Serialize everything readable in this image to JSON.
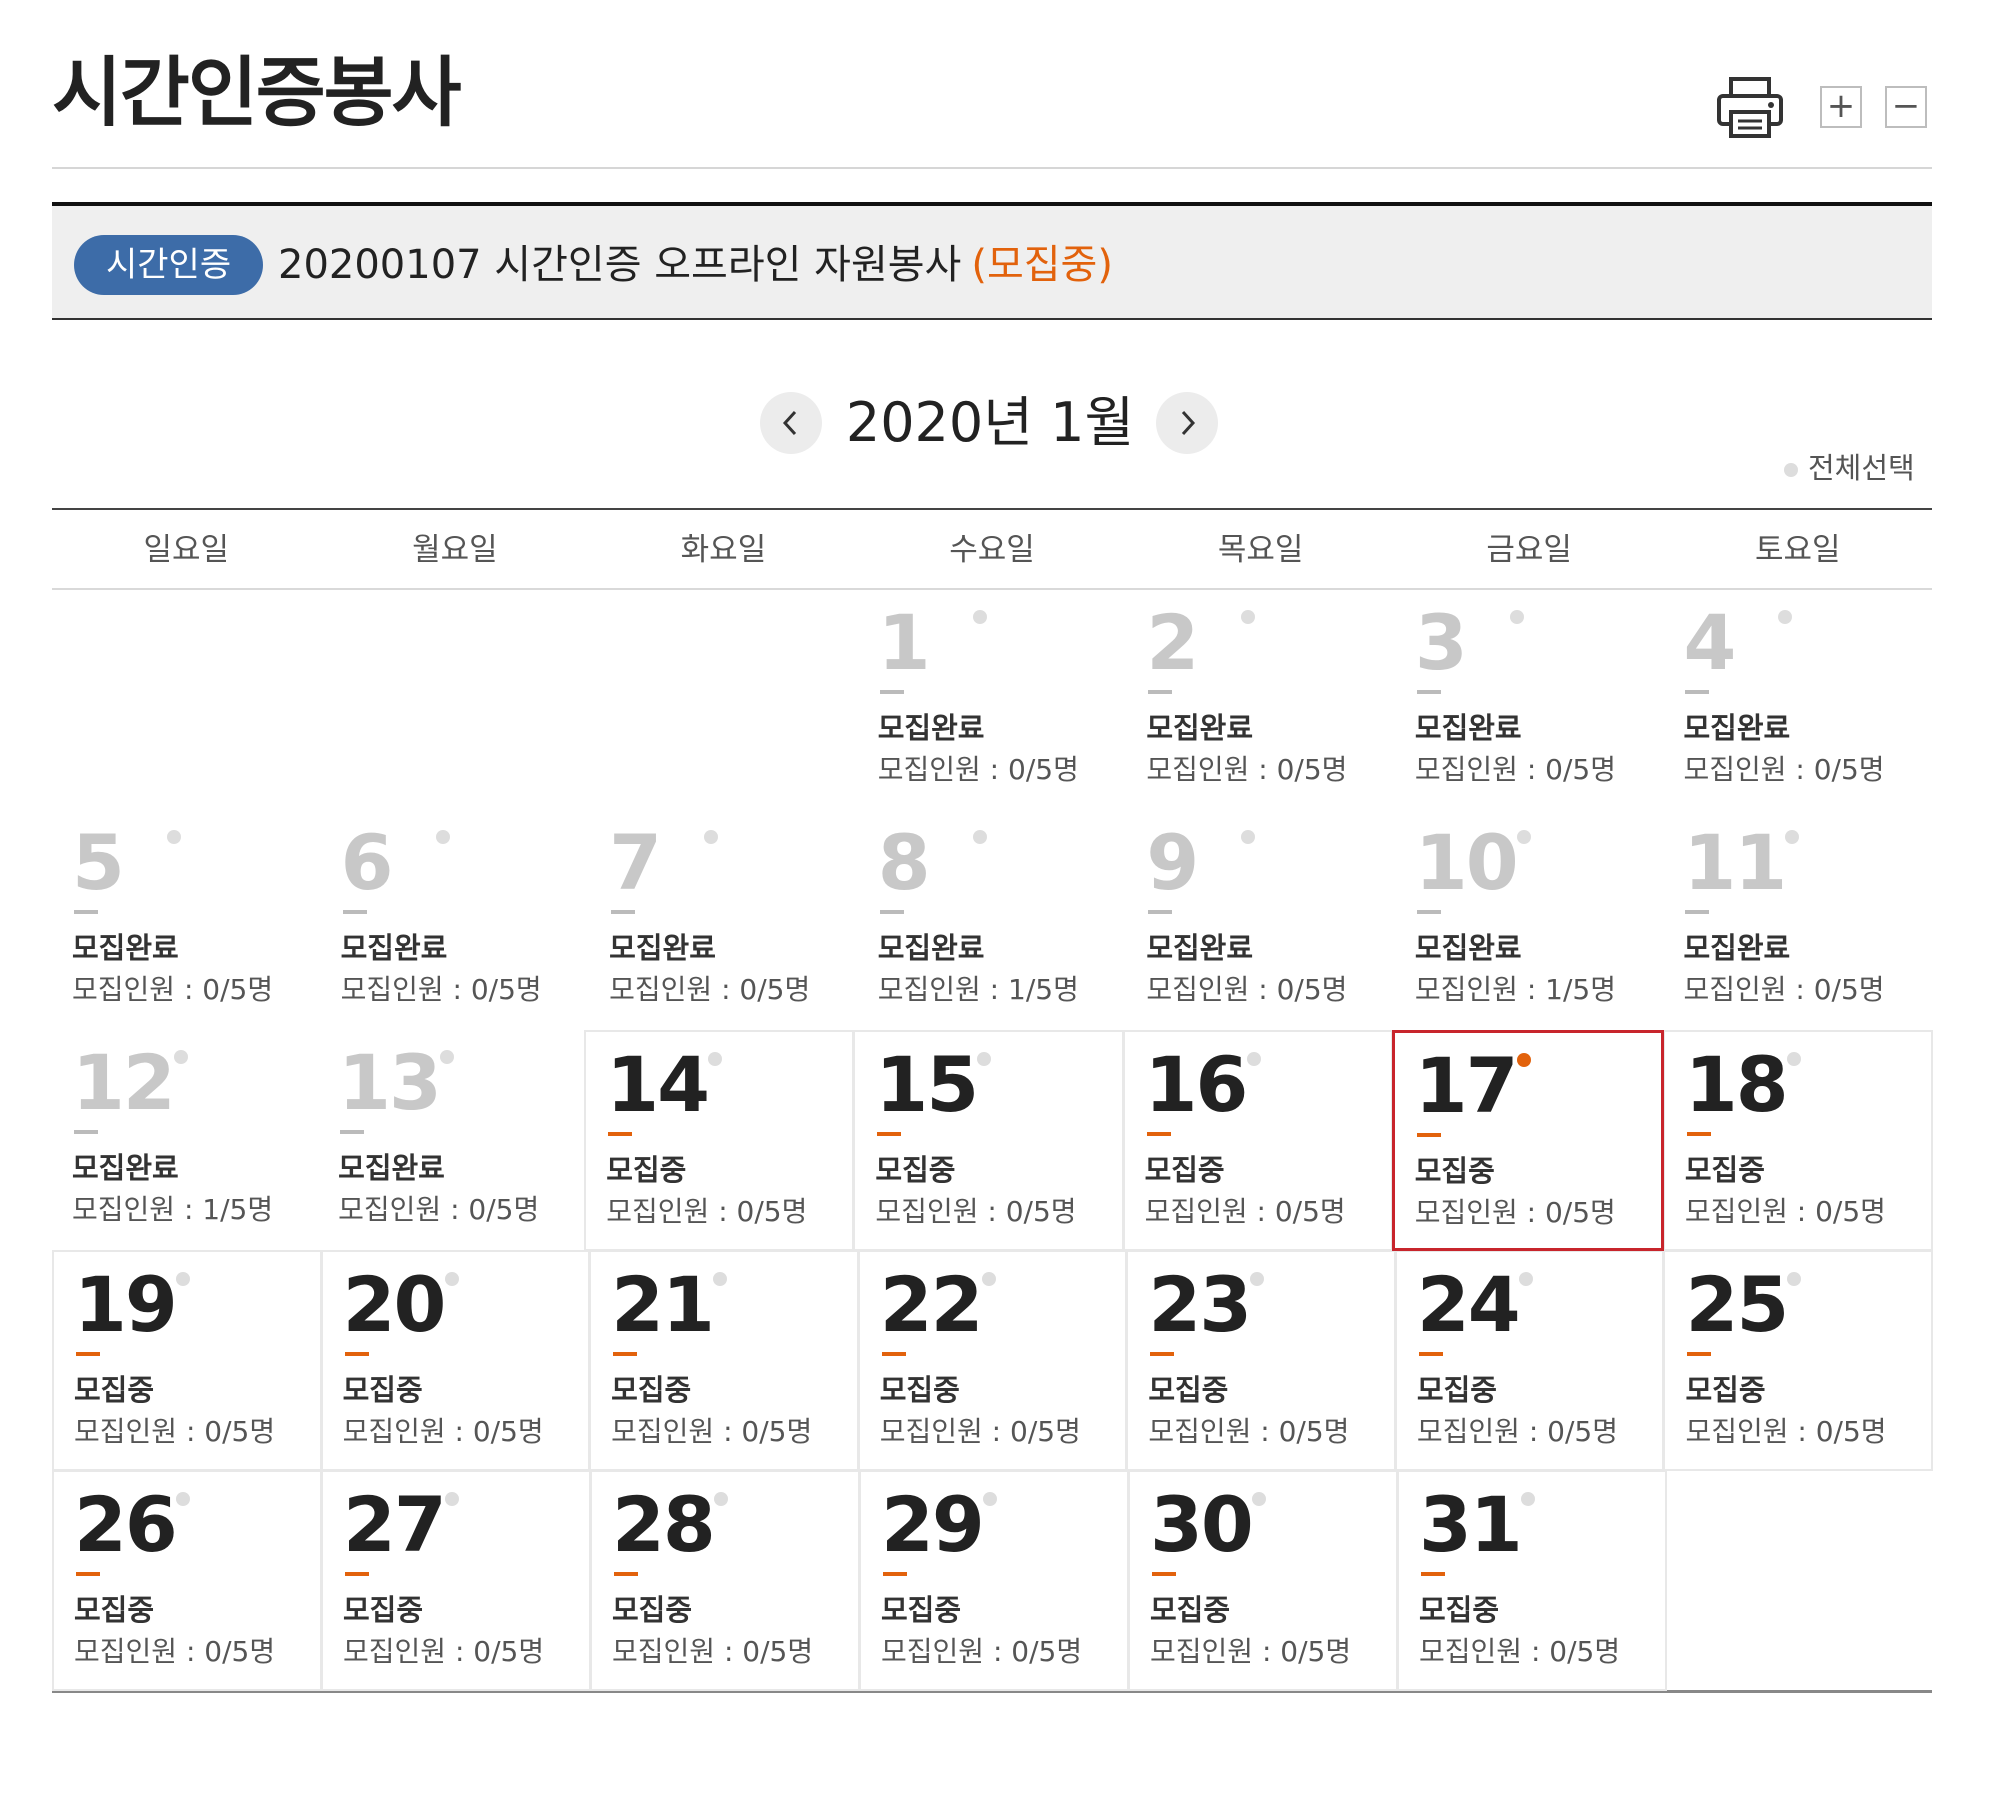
{
  "page": {
    "title": "시간인증봉사"
  },
  "tools": {
    "print_label": "",
    "zoom_in": "+",
    "zoom_out": "−"
  },
  "program": {
    "type_badge": "시간인증",
    "name": "20200107 시간인증 오프라인 자원봉사",
    "status": "(모집중)"
  },
  "calendar": {
    "month_label": "2020년 1월",
    "select_all": "전체선택",
    "weekdays": [
      "일요일",
      "월요일",
      "화요일",
      "수요일",
      "목요일",
      "금요일",
      "토요일"
    ],
    "selected_day": 17,
    "colors": {
      "accent": "#e2620c",
      "selected_border": "#c8252c",
      "badge": "#3d6ca8"
    },
    "days": [
      {
        "day": "1",
        "status": "모집완료",
        "count": "모집인원 : 0/5명",
        "open": false
      },
      {
        "day": "2",
        "status": "모집완료",
        "count": "모집인원 : 0/5명",
        "open": false
      },
      {
        "day": "3",
        "status": "모집완료",
        "count": "모집인원 : 0/5명",
        "open": false
      },
      {
        "day": "4",
        "status": "모집완료",
        "count": "모집인원 : 0/5명",
        "open": false
      },
      {
        "day": "5",
        "status": "모집완료",
        "count": "모집인원 : 0/5명",
        "open": false
      },
      {
        "day": "6",
        "status": "모집완료",
        "count": "모집인원 : 0/5명",
        "open": false
      },
      {
        "day": "7",
        "status": "모집완료",
        "count": "모집인원 : 0/5명",
        "open": false
      },
      {
        "day": "8",
        "status": "모집완료",
        "count": "모집인원 : 1/5명",
        "open": false
      },
      {
        "day": "9",
        "status": "모집완료",
        "count": "모집인원 : 0/5명",
        "open": false
      },
      {
        "day": "10",
        "status": "모집완료",
        "count": "모집인원 : 1/5명",
        "open": false
      },
      {
        "day": "11",
        "status": "모집완료",
        "count": "모집인원 : 0/5명",
        "open": false
      },
      {
        "day": "12",
        "status": "모집완료",
        "count": "모집인원 : 1/5명",
        "open": false
      },
      {
        "day": "13",
        "status": "모집완료",
        "count": "모집인원 : 0/5명",
        "open": false
      },
      {
        "day": "14",
        "status": "모집중",
        "count": "모집인원 : 0/5명",
        "open": true
      },
      {
        "day": "15",
        "status": "모집중",
        "count": "모집인원 : 0/5명",
        "open": true
      },
      {
        "day": "16",
        "status": "모집중",
        "count": "모집인원 : 0/5명",
        "open": true
      },
      {
        "day": "17",
        "status": "모집중",
        "count": "모집인원 : 0/5명",
        "open": true
      },
      {
        "day": "18",
        "status": "모집중",
        "count": "모집인원 : 0/5명",
        "open": true
      },
      {
        "day": "19",
        "status": "모집중",
        "count": "모집인원 : 0/5명",
        "open": true
      },
      {
        "day": "20",
        "status": "모집중",
        "count": "모집인원 : 0/5명",
        "open": true
      },
      {
        "day": "21",
        "status": "모집중",
        "count": "모집인원 : 0/5명",
        "open": true
      },
      {
        "day": "22",
        "status": "모집중",
        "count": "모집인원 : 0/5명",
        "open": true
      },
      {
        "day": "23",
        "status": "모집중",
        "count": "모집인원 : 0/5명",
        "open": true
      },
      {
        "day": "24",
        "status": "모집중",
        "count": "모집인원 : 0/5명",
        "open": true
      },
      {
        "day": "25",
        "status": "모집중",
        "count": "모집인원 : 0/5명",
        "open": true
      },
      {
        "day": "26",
        "status": "모집중",
        "count": "모집인원 : 0/5명",
        "open": true
      },
      {
        "day": "27",
        "status": "모집중",
        "count": "모집인원 : 0/5명",
        "open": true
      },
      {
        "day": "28",
        "status": "모집중",
        "count": "모집인원 : 0/5명",
        "open": true
      },
      {
        "day": "29",
        "status": "모집중",
        "count": "모집인원 : 0/5명",
        "open": true
      },
      {
        "day": "30",
        "status": "모집중",
        "count": "모집인원 : 0/5명",
        "open": true
      },
      {
        "day": "31",
        "status": "모집중",
        "count": "모집인원 : 0/5명",
        "open": true
      }
    ]
  }
}
